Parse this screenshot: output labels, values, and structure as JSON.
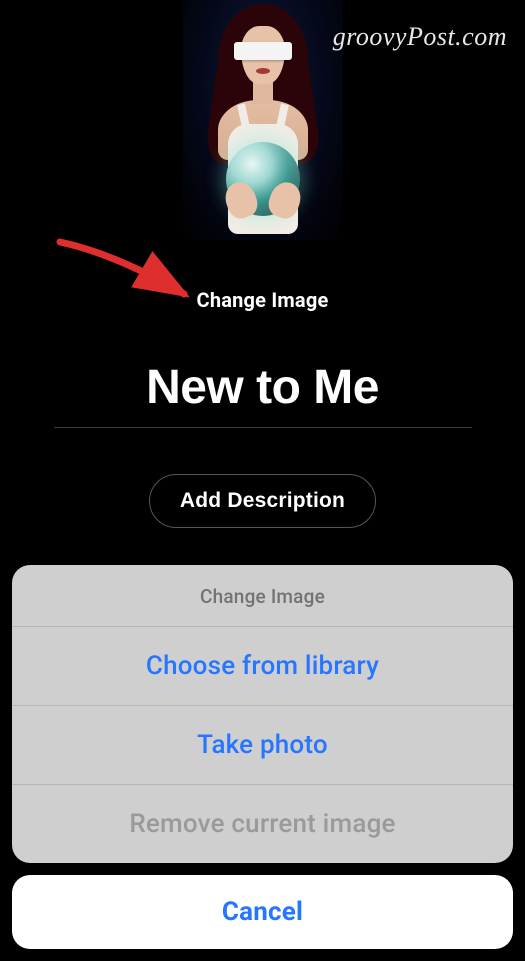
{
  "watermark": "groovyPost.com",
  "change_image_label": "Change Image",
  "playlist_title": "New to Me",
  "add_description_label": "Add Description",
  "action_sheet": {
    "title": "Change Image",
    "options": [
      {
        "label": "Choose from library",
        "style": "blue"
      },
      {
        "label": "Take photo",
        "style": "blue"
      },
      {
        "label": "Remove current image",
        "style": "gray"
      }
    ],
    "cancel_label": "Cancel"
  }
}
